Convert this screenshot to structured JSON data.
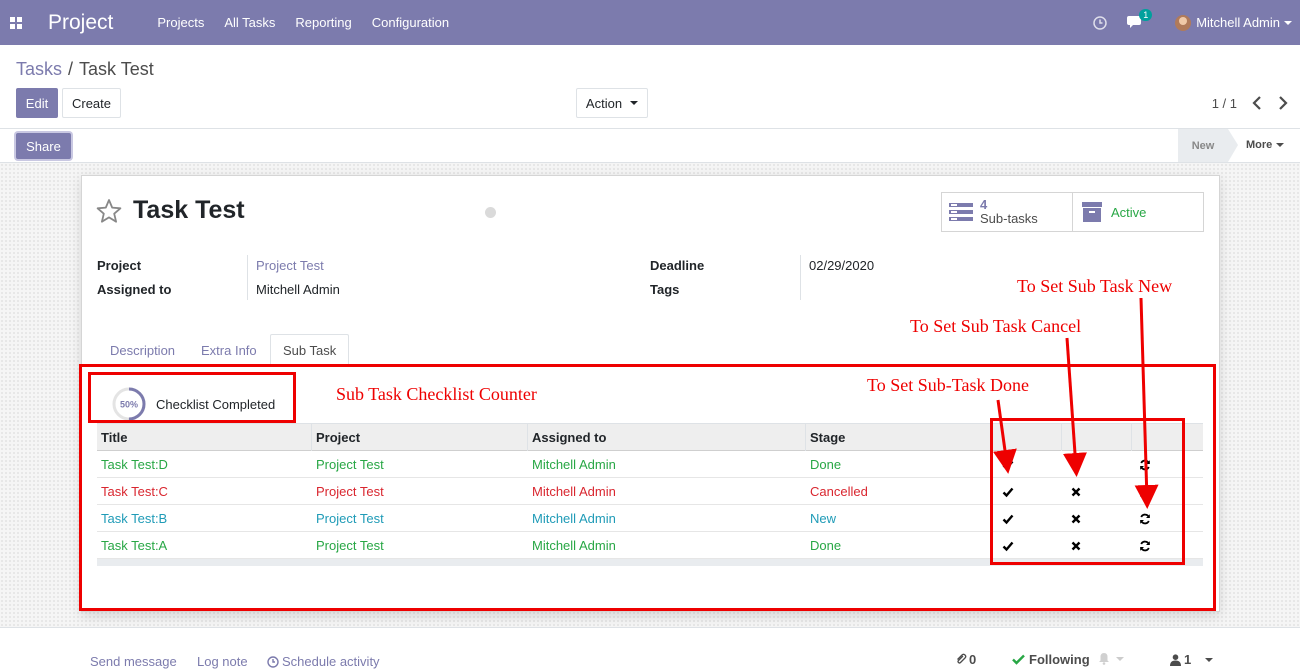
{
  "navbar": {
    "app_title": "Project",
    "menu": [
      "Projects",
      "All Tasks",
      "Reporting",
      "Configuration"
    ],
    "chat_count": "1",
    "user_name": "Mitchell Admin"
  },
  "breadcrumb": {
    "parent": "Tasks",
    "separator": "/",
    "current": "Task Test"
  },
  "toolbar": {
    "edit_label": "Edit",
    "create_label": "Create",
    "action_label": "Action",
    "pager": "1 / 1"
  },
  "statusbar": {
    "share_label": "Share",
    "stage_new": "New",
    "more_label": "More"
  },
  "record": {
    "title": "Task Test",
    "smart_buttons": {
      "subtasks_count": "4",
      "subtasks_label": "Sub-tasks",
      "active_label": "Active"
    },
    "fields": {
      "project_label": "Project",
      "project_value": "Project Test",
      "assigned_label": "Assigned to",
      "assigned_value": "Mitchell Admin",
      "deadline_label": "Deadline",
      "deadline_value": "02/29/2020",
      "tags_label": "Tags"
    },
    "tabs": [
      "Description",
      "Extra Info",
      "Sub Task"
    ]
  },
  "checklist": {
    "percent": "50%",
    "percent_value": 50,
    "label": "Checklist Completed"
  },
  "table": {
    "headers": [
      "Title",
      "Project",
      "Assigned to",
      "Stage"
    ],
    "rows": [
      {
        "title": "Task Test:D",
        "project": "Project Test",
        "assigned": "Mitchell Admin",
        "stage": "Done",
        "color": "#28a745"
      },
      {
        "title": "Task Test:C",
        "project": "Project Test",
        "assigned": "Mitchell Admin",
        "stage": "Cancelled",
        "color": "#d9262f"
      },
      {
        "title": "Task Test:B",
        "project": "Project Test",
        "assigned": "Mitchell Admin",
        "stage": "New",
        "color": "#1f9bb7"
      },
      {
        "title": "Task Test:A",
        "project": "Project Test",
        "assigned": "Mitchell Admin",
        "stage": "Done",
        "color": "#28a745"
      }
    ]
  },
  "annotations": {
    "counter": "Sub Task Checklist Counter",
    "done": "To Set Sub-Task Done",
    "cancel": "To Set Sub Task Cancel",
    "new": "To Set Sub Task New"
  },
  "chatter": {
    "send_message": "Send message",
    "log_note": "Log note",
    "schedule_activity": "Schedule activity",
    "attachments": "0",
    "following": "Following",
    "followers": "1"
  },
  "colors": {
    "brand": "#7c7bad",
    "annotation": "#ee0000"
  }
}
